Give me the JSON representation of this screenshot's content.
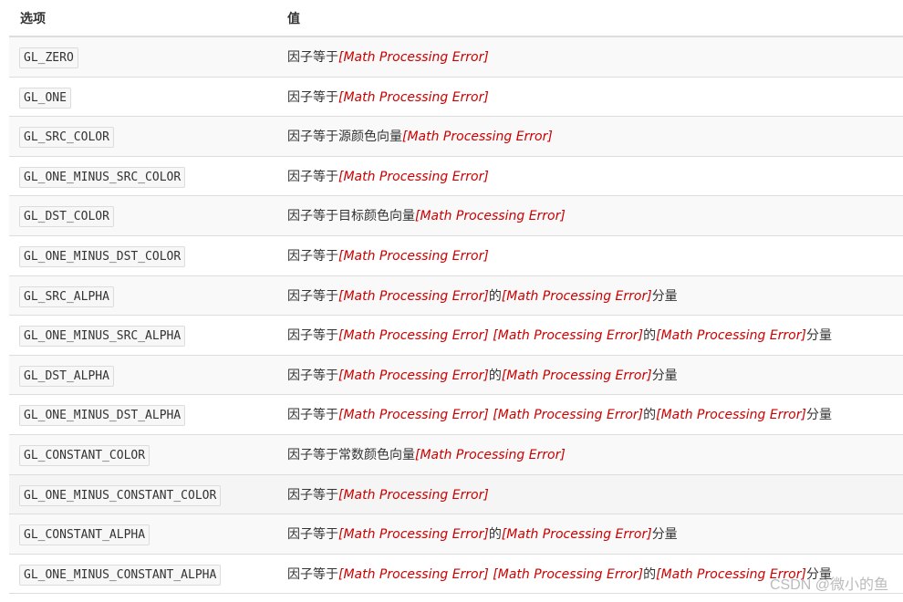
{
  "header": {
    "col_option": "选项",
    "col_value": "值"
  },
  "rows": [
    {
      "option": "GL_ZERO",
      "parts": [
        "因子等于",
        "[Math Processing Error]"
      ]
    },
    {
      "option": "GL_ONE",
      "parts": [
        "因子等于",
        "[Math Processing Error]"
      ]
    },
    {
      "option": "GL_SRC_COLOR",
      "parts": [
        "因子等于源颜色向量",
        "[Math Processing Error]"
      ]
    },
    {
      "option": "GL_ONE_MINUS_SRC_COLOR",
      "parts": [
        "因子等于",
        "[Math Processing Error]"
      ]
    },
    {
      "option": "GL_DST_COLOR",
      "parts": [
        "因子等于目标颜色向量",
        "[Math Processing Error]"
      ]
    },
    {
      "option": "GL_ONE_MINUS_DST_COLOR",
      "parts": [
        "因子等于",
        "[Math Processing Error]"
      ]
    },
    {
      "option": "GL_SRC_ALPHA",
      "parts": [
        "因子等于",
        "[Math Processing Error]",
        "的",
        "[Math Processing Error]",
        "分量"
      ]
    },
    {
      "option": "GL_ONE_MINUS_SRC_ALPHA",
      "parts": [
        "因子等于",
        "[Math Processing Error] [Math Processing Error]",
        "的",
        "[Math Processing Error]",
        "分量"
      ]
    },
    {
      "option": "GL_DST_ALPHA",
      "parts": [
        "因子等于",
        "[Math Processing Error]",
        "的",
        "[Math Processing Error]",
        "分量"
      ]
    },
    {
      "option": "GL_ONE_MINUS_DST_ALPHA",
      "parts": [
        "因子等于",
        "[Math Processing Error] [Math Processing Error]",
        "的",
        "[Math Processing Error]",
        "分量"
      ]
    },
    {
      "option": "GL_CONSTANT_COLOR",
      "parts": [
        "因子等于常数颜色向量",
        "[Math Processing Error]"
      ]
    },
    {
      "option": "GL_ONE_MINUS_CONSTANT_COLOR",
      "parts": [
        "因子等于",
        "[Math Processing Error]"
      ]
    },
    {
      "option": "GL_CONSTANT_ALPHA",
      "parts": [
        "因子等于",
        "[Math Processing Error]",
        "的",
        "[Math Processing Error]",
        "分量"
      ]
    },
    {
      "option": "GL_ONE_MINUS_CONSTANT_ALPHA",
      "parts": [
        "因子等于",
        "[Math Processing Error] [Math Processing Error]",
        "的",
        "[Math Processing Error]",
        "分量"
      ]
    }
  ],
  "watermark": "CSDN @微小的鱼",
  "colors": {
    "error": "#cc0000",
    "border": "#dddddd",
    "stripe": "#f9f9f9"
  }
}
